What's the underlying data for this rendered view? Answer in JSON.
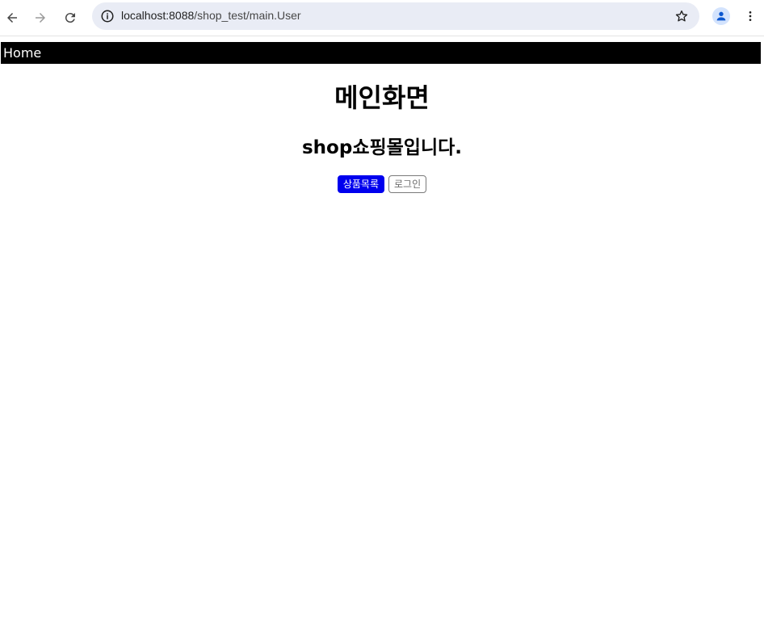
{
  "browser": {
    "url_host": "localhost:8088",
    "url_path": "/shop_test/main.User",
    "icons": {
      "back": "arrow-left-icon",
      "forward": "arrow-right-icon",
      "reload": "reload-icon",
      "site_info": "info-icon",
      "bookmark": "star-icon",
      "profile": "person-icon",
      "menu": "kebab-menu-icon"
    }
  },
  "page": {
    "nav": {
      "home_label": "Home"
    },
    "title": "메인화면",
    "subtitle": "shop쇼핑몰입니다.",
    "buttons": {
      "products_label": "상품목록",
      "login_label": "로그인"
    },
    "colors": {
      "navbar_bg": "#000000",
      "primary_button": "#0000ee"
    }
  }
}
